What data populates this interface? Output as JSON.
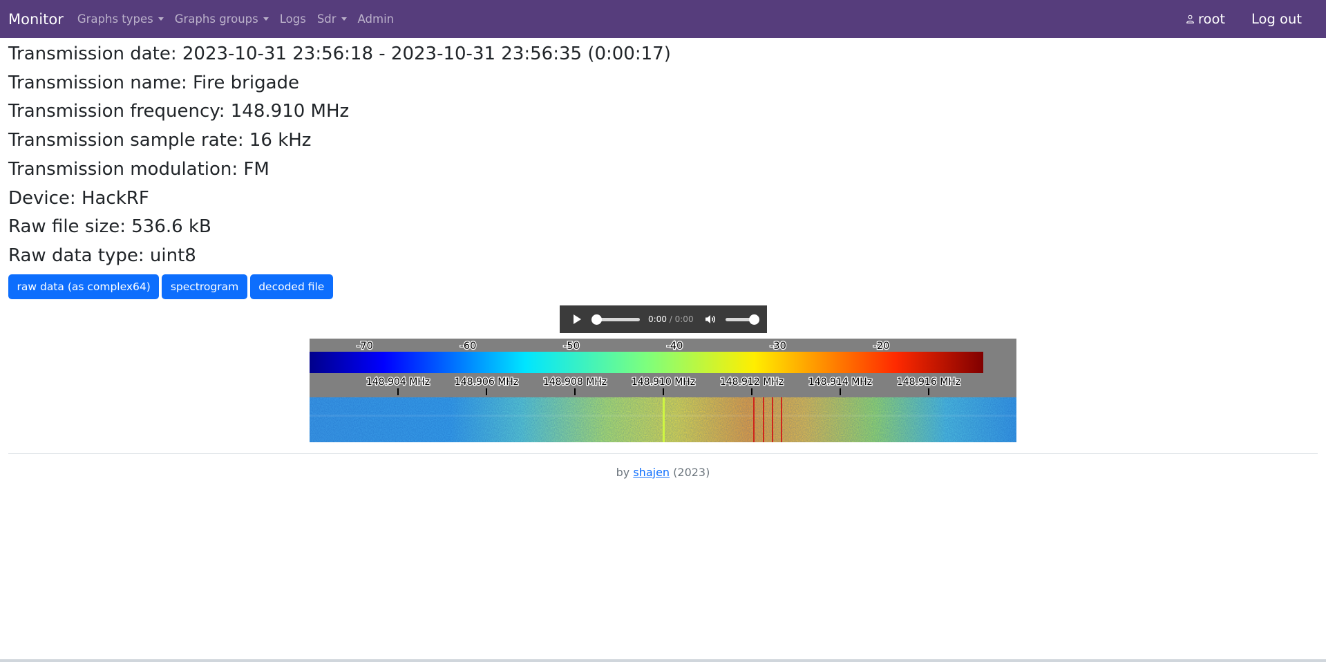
{
  "navbar": {
    "brand": "Monitor",
    "items": [
      {
        "label": "Graphs types",
        "dropdown": true
      },
      {
        "label": "Graphs groups",
        "dropdown": true
      },
      {
        "label": "Logs",
        "dropdown": false
      },
      {
        "label": "Sdr",
        "dropdown": true
      },
      {
        "label": "Admin",
        "dropdown": false
      }
    ],
    "user": "root",
    "logout": "Log out"
  },
  "info": {
    "date": "Transmission date: 2023-10-31 23:56:18 - 2023-10-31 23:56:35 (0:00:17)",
    "name": "Transmission name: Fire brigade",
    "frequency": "Transmission frequency: 148.910 MHz",
    "sample_rate": "Transmission sample rate: 16 kHz",
    "modulation": "Transmission modulation: FM",
    "device": "Device: HackRF",
    "file_size": "Raw file size: 536.6 kB",
    "data_type": "Raw data type: uint8"
  },
  "buttons": {
    "raw": "raw data (as complex64)",
    "spectrogram": "spectrogram",
    "decoded": "decoded file"
  },
  "player": {
    "current": "0:00",
    "separator": " / ",
    "duration": "0:00",
    "progress": 0,
    "volume": 1
  },
  "spectrogram": {
    "colorbar_ticks": [
      "-70",
      "-60",
      "-50",
      "-40",
      "-30",
      "-20"
    ],
    "freq_ticks": [
      "148.904 MHz",
      "148.906 MHz",
      "148.908 MHz",
      "148.910 MHz",
      "148.912 MHz",
      "148.914 MHz",
      "148.916 MHz"
    ],
    "colors": {
      "background": "#808080",
      "accent_line": "#d2ff3c"
    }
  },
  "footer": {
    "prefix": "by ",
    "author": "shajen",
    "suffix": " (2023)"
  },
  "colors": {
    "navbar": "#563d7c",
    "button": "#0d6efd",
    "player": "#3b3b3b"
  }
}
